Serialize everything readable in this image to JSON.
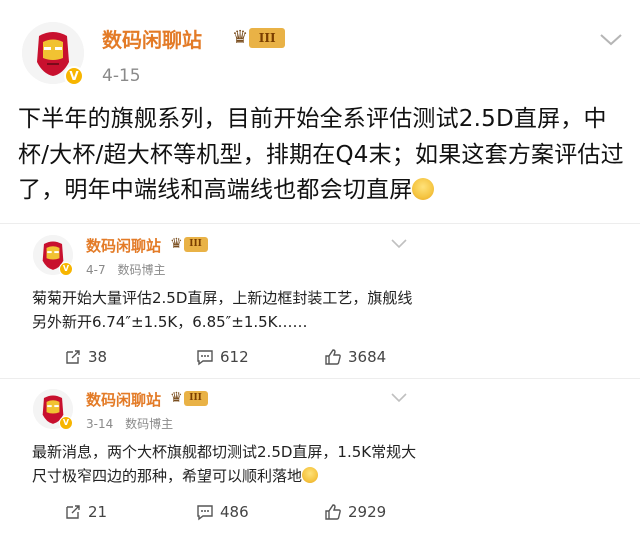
{
  "main_post": {
    "author": "数码闲聊站",
    "level": "III",
    "date": "4-15",
    "text": "下半年的旗舰系列，目前开始全系评估测试2.5D直屏，中杯/大杯/超大杯等机型，排期在Q4末；如果这套方案评估过了，明年中端线和高端线也都会切直屏"
  },
  "reposts": [
    {
      "author": "数码闲聊站",
      "level": "III",
      "date": "4-7",
      "tag": "数码博主",
      "text": "菊菊开始大量评估2.5D直屏，上新边框封装工艺，旗舰线另外新开6.74″±1.5K，6.85″±1.5K……",
      "reposts_count": "38",
      "comments_count": "612",
      "likes_count": "3684"
    },
    {
      "author": "数码闲聊站",
      "level": "III",
      "date": "3-14",
      "tag": "数码博主",
      "text": "最新消息，两个大杯旗舰都切测试2.5D直屏，1.5K常规大尺寸极窄四边的那种，希望可以顺利落地",
      "reposts_count": "21",
      "comments_count": "486",
      "likes_count": "2929"
    }
  ],
  "colors": {
    "name": "#e37b27",
    "meta": "#8a8a8a",
    "badge": "#f7b500"
  },
  "icons": [
    "iron-man-avatar",
    "verified-badge-icon",
    "crown-icon",
    "chevron-down-icon",
    "repost-icon",
    "comment-icon",
    "like-icon",
    "smiley-emoji-icon"
  ]
}
